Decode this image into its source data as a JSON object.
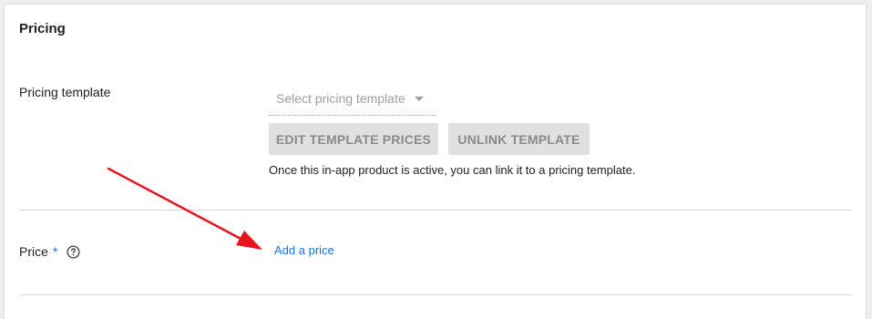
{
  "section": {
    "title": "Pricing"
  },
  "pricing_template": {
    "label": "Pricing template",
    "select_placeholder": "Select pricing template",
    "edit_button": "EDIT TEMPLATE PRICES",
    "unlink_button": "UNLINK TEMPLATE",
    "helper": "Once this in-app product is active, you can link it to a pricing template."
  },
  "price": {
    "label": "Price",
    "required_marker": "*",
    "add_link": "Add a price",
    "help_icon": "question-circle-icon"
  },
  "annotation": {
    "arrow_color": "#e8141b",
    "icon": "arrow-annotation"
  },
  "colors": {
    "accent": "#1a73e8",
    "button_bg": "#e0e0e0",
    "button_text": "#8a8a8a"
  }
}
